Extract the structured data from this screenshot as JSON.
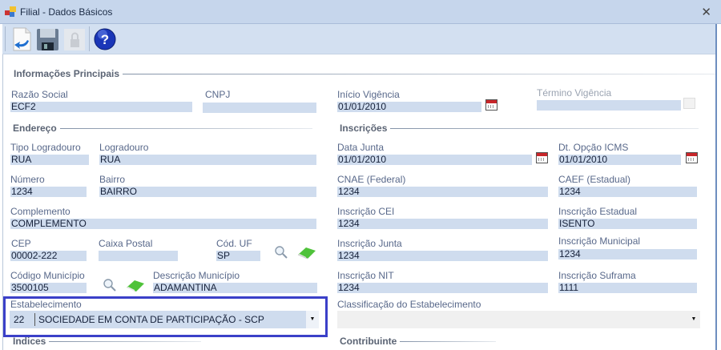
{
  "window": {
    "title": "Filial - Dados Básicos",
    "close": "✕"
  },
  "toolbar": {
    "items": [
      {
        "name": "new-document-icon"
      },
      {
        "name": "save-icon"
      },
      {
        "name": "lock-icon"
      },
      {
        "name": "help-icon",
        "label": "?"
      }
    ]
  },
  "sections": {
    "principal": "Informações Principais",
    "endereco": "Endereço",
    "inscricoes": "Inscrições",
    "indices": "Indices",
    "contribuinte": "Contribuinte"
  },
  "fields": {
    "razao_social": {
      "label": "Razão Social",
      "value": "ECF2"
    },
    "cnpj": {
      "label": "CNPJ",
      "value": ""
    },
    "inicio_vigencia": {
      "label": "Início Vigência",
      "value": "01/01/2010"
    },
    "termino_vigencia": {
      "label": "Término Vigência",
      "value": ""
    },
    "tipo_logradouro": {
      "label": "Tipo Logradouro",
      "value": "RUA"
    },
    "logradouro": {
      "label": "Logradouro",
      "value": "RUA"
    },
    "numero": {
      "label": "Número",
      "value": "1234"
    },
    "bairro": {
      "label": "Bairro",
      "value": "BAIRRO"
    },
    "complemento": {
      "label": "Complemento",
      "value": "COMPLEMENTO"
    },
    "cep": {
      "label": "CEP",
      "value": "00002-222"
    },
    "caixa_postal": {
      "label": "Caixa Postal",
      "value": ""
    },
    "cod_uf": {
      "label": "Cód. UF",
      "value": "SP"
    },
    "codigo_municipio": {
      "label": "Código Município",
      "value": "3500105"
    },
    "descricao_municipio": {
      "label": "Descrição Município",
      "value": "ADAMANTINA"
    },
    "data_junta": {
      "label": "Data Junta",
      "value": "01/01/2010"
    },
    "dt_opcao_icms": {
      "label": "Dt. Opção ICMS",
      "value": "01/01/2010"
    },
    "cnae": {
      "label": "CNAE (Federal)",
      "value": "1234"
    },
    "caef": {
      "label": "CAEF (Estadual)",
      "value": "1234"
    },
    "insc_cei": {
      "label": "Inscrição CEI",
      "value": "1234"
    },
    "insc_estadual": {
      "label": "Inscrição Estadual",
      "value": "ISENTO"
    },
    "insc_junta": {
      "label": "Inscrição Junta",
      "value": "1234"
    },
    "insc_municipal": {
      "label": "Inscrição Municipal",
      "value": "1234"
    },
    "insc_nit": {
      "label": "Inscrição NIT",
      "value": "1234"
    },
    "insc_suframa": {
      "label": "Inscrição Suframa",
      "value": "1111"
    },
    "estabelecimento": {
      "label": "Estabelecimento",
      "code": "22",
      "value": "SOCIEDADE EM CONTA DE PARTICIPAÇÃO - SCP",
      "arrow": "▼"
    },
    "classificacao": {
      "label": "Classificação do Estabelecimento",
      "value": "",
      "arrow": "▼"
    }
  },
  "colors": {
    "highlight": "#3b40c8",
    "input_bg": "#cfdcee"
  }
}
